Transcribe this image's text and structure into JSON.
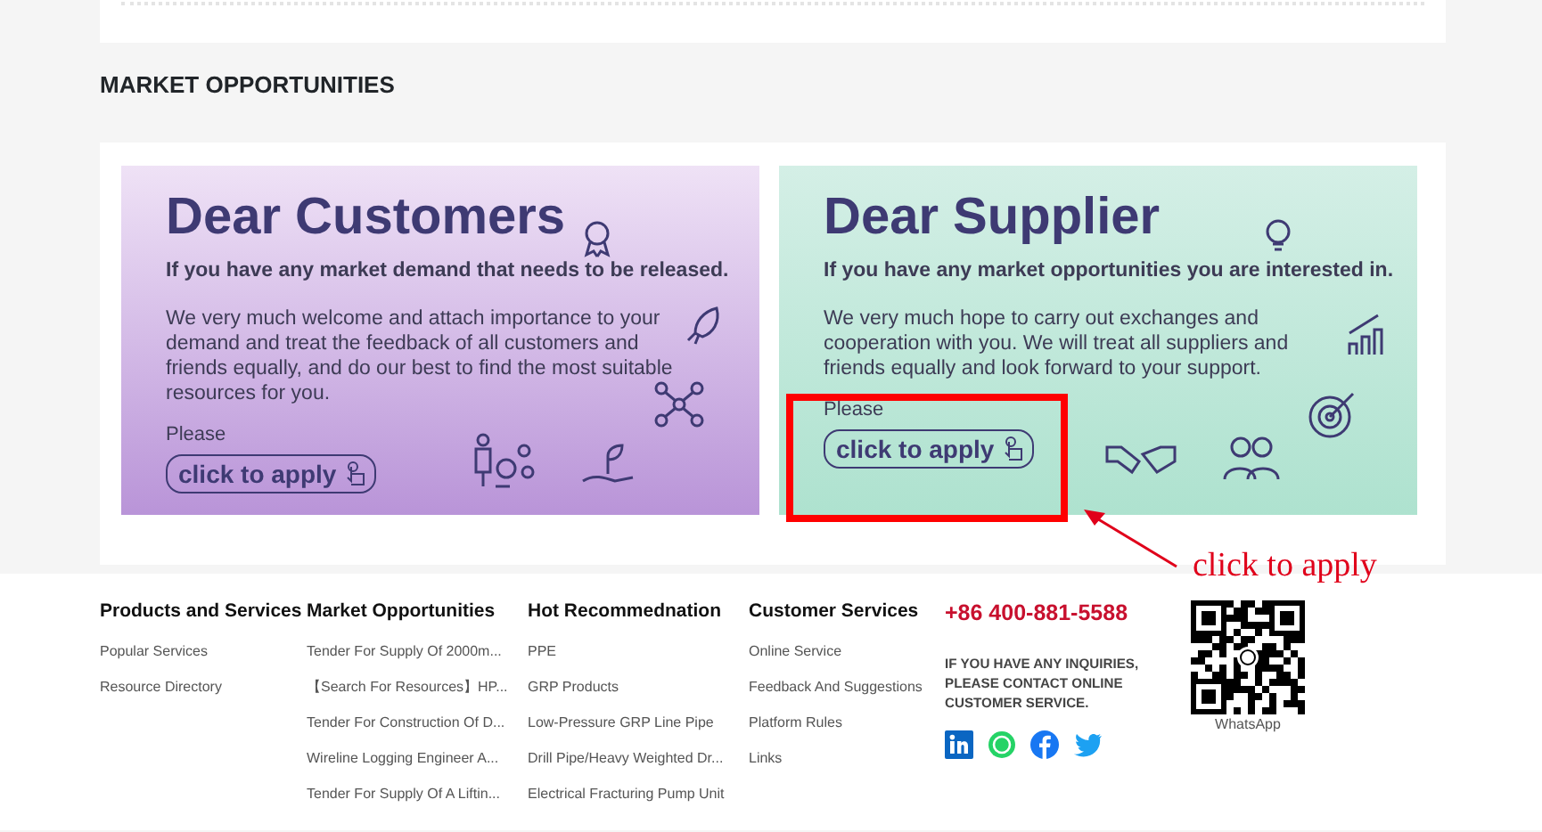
{
  "section_title": "MARKET OPPORTUNITIES",
  "banners": [
    {
      "kind": "customer",
      "title": "Dear Customers",
      "subtitle": "If you have any market demand that needs to be released.",
      "body": "We very much welcome and attach importance to your demand and treat the feedback of all customers and friends equally, and do our best to find the most suitable resources for you.",
      "prompt": "Please",
      "button": "click to apply",
      "highlighted": false
    },
    {
      "kind": "supplier",
      "title": "Dear Supplier",
      "subtitle": "If you have any market opportunities you are interested in.",
      "body": "We very much hope to carry out exchanges and cooperation with you. We will treat all suppliers and friends equally and look forward to your support.",
      "prompt": "Please",
      "button": "click to apply",
      "highlighted": true
    }
  ],
  "annotation": "click to apply",
  "footer": {
    "columns": [
      {
        "heading": "Products and Services",
        "links": [
          "Popular Services",
          "Resource Directory"
        ]
      },
      {
        "heading": "Market Opportunities",
        "links": [
          "Tender For Supply Of 2000m...",
          "【Search For Resources】HP...",
          "Tender For Construction Of D...",
          "Wireline Logging Engineer A...",
          "Tender For Supply Of A Liftin..."
        ]
      },
      {
        "heading": "Hot Recommednation",
        "links": [
          "PPE",
          "GRP Products",
          "Low-Pressure GRP Line Pipe",
          "Drill Pipe/Heavy Weighted Dr...",
          "Electrical Fracturing Pump Unit"
        ]
      },
      {
        "heading": "Customer Services",
        "links": [
          "Online Service",
          "Feedback And Suggestions",
          "Platform Rules",
          "Links"
        ]
      }
    ],
    "phone": "+86 400-881-5588",
    "notice": "IF YOU HAVE ANY INQUIRIES, PLEASE CONTACT ONLINE CUSTOMER SERVICE.",
    "socials": [
      {
        "kind": "linkedin"
      },
      {
        "kind": "whatsapp"
      },
      {
        "kind": "facebook"
      },
      {
        "kind": "twitter"
      }
    ],
    "qr_caption": "WhatsApp"
  }
}
